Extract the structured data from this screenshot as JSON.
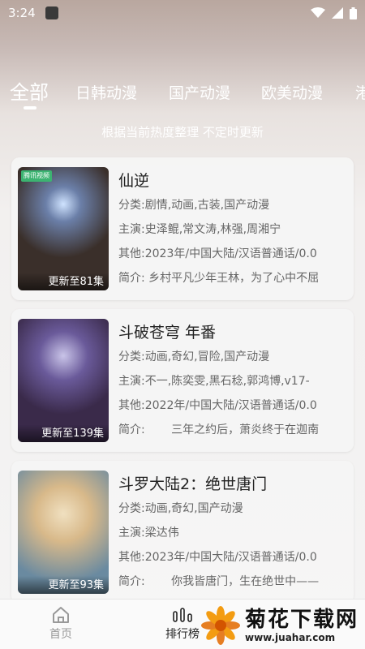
{
  "status_bar": {
    "time": "3:24"
  },
  "tabs": [
    {
      "label": "全部",
      "active": true
    },
    {
      "label": "日韩动漫",
      "active": false
    },
    {
      "label": "国产动漫",
      "active": false
    },
    {
      "label": "欧美动漫",
      "active": false
    },
    {
      "label": "港",
      "active": false
    }
  ],
  "subtitle": "根据当前热度整理 不定时更新",
  "cards": [
    {
      "title": "仙逆",
      "category_label": "分类:",
      "category": "剧情,动画,古装,国产动漫",
      "cast_label": "主演:",
      "cast": "史泽鲲,常文涛,林强,周湘宁",
      "other_label": "其他:",
      "other": "2023年/中国大陆/汉语普通话/0.0",
      "intro_label": "简介:",
      "intro": "乡村平凡少年王林，为了心中不屈",
      "badge": "更新至81集",
      "poster_tag": "腾讯视频",
      "poster_colors": [
        "#2b2f3a",
        "#8a6a3a",
        "#c9a25c"
      ]
    },
    {
      "title": "斗破苍穹 年番",
      "category_label": "分类:",
      "category": "动画,奇幻,冒险,国产动漫",
      "cast_label": "主演:",
      "cast": "不一,陈奕雯,黑石稔,郭鸿博,v17-",
      "other_label": "其他:",
      "other": "2022年/中国大陆/汉语普通话/0.0",
      "intro_label": "简介:",
      "intro": "　　三年之约后，萧炎终于在迦南",
      "badge": "更新至139集",
      "poster_tag": "",
      "poster_colors": [
        "#3a3f6a",
        "#7a4a7a",
        "#c75a4a"
      ]
    },
    {
      "title": "斗罗大陆2：绝世唐门",
      "category_label": "分类:",
      "category": "动画,奇幻,国产动漫",
      "cast_label": "主演:",
      "cast": "梁达伟",
      "other_label": "其他:",
      "other": "2023年/中国大陆/汉语普通话/0.0",
      "intro_label": "简介:",
      "intro": "　　你我皆唐门，生在绝世中——",
      "badge": "更新至93集",
      "poster_tag": "",
      "poster_colors": [
        "#9ac6e0",
        "#d8b98a",
        "#6a8aa0"
      ]
    }
  ],
  "bottom_nav": {
    "home_label": "首页",
    "rank_label": "排行榜"
  },
  "watermark": {
    "title": "菊花下载网",
    "url": "www.juahar.com"
  }
}
